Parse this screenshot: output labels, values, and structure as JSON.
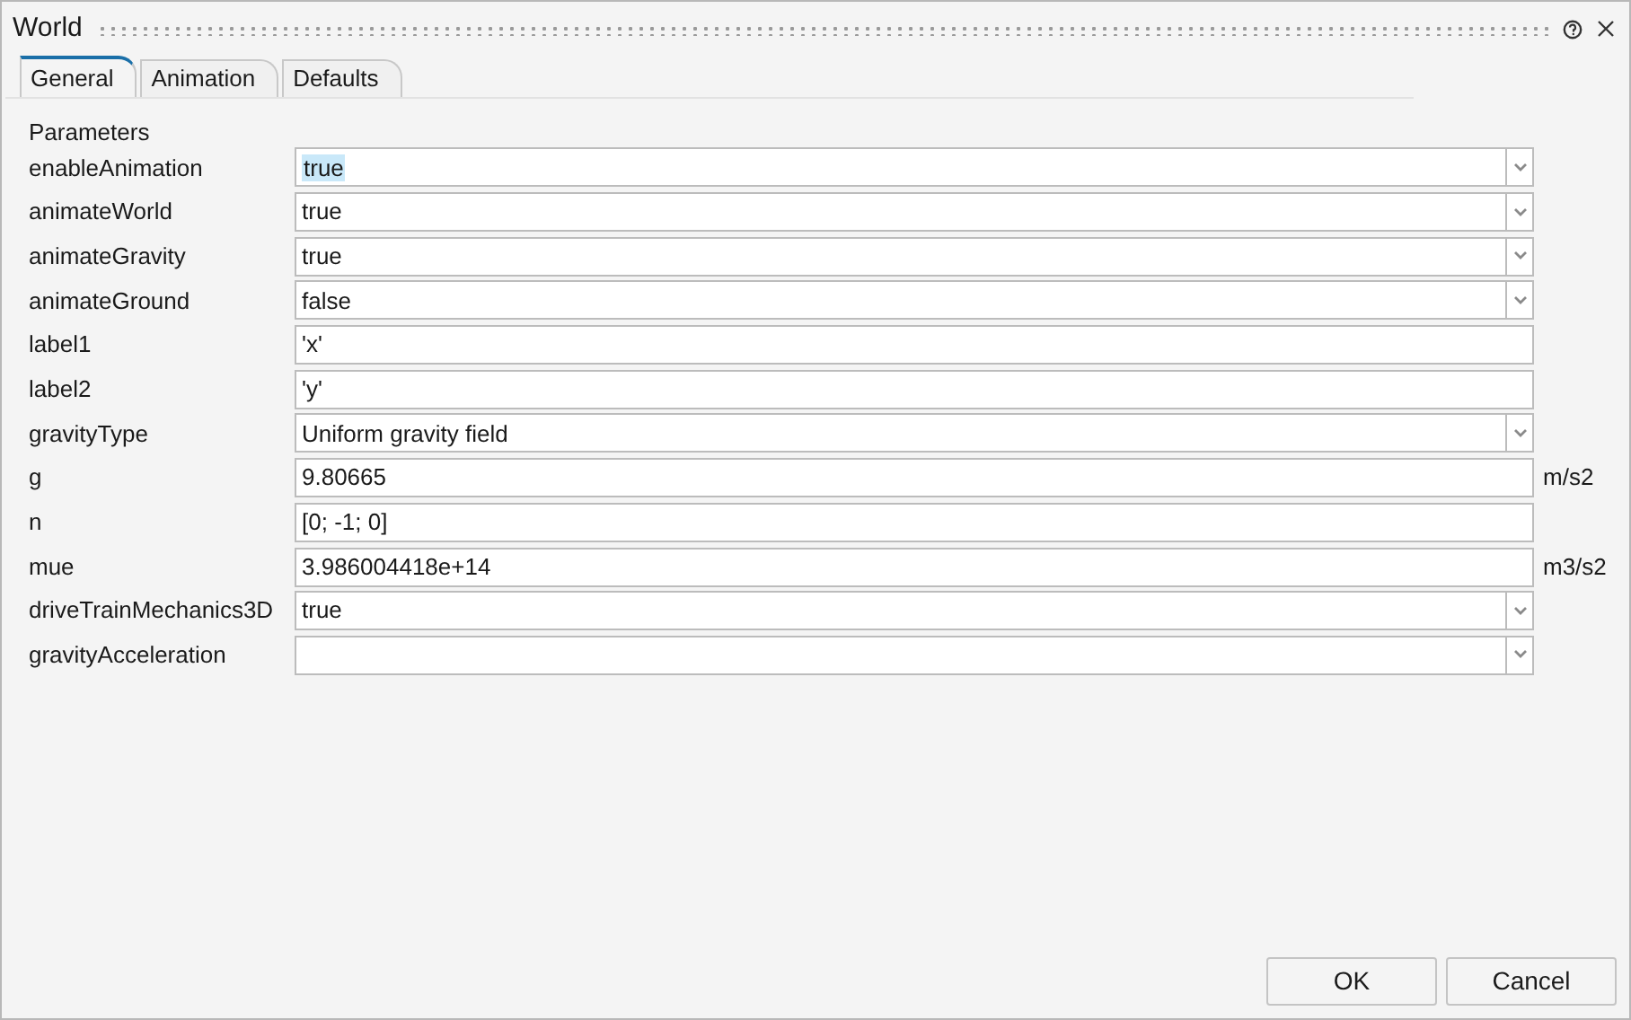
{
  "window": {
    "title": "World"
  },
  "tabs": [
    {
      "label": "General",
      "selected": true
    },
    {
      "label": "Animation",
      "selected": false
    },
    {
      "label": "Defaults",
      "selected": false
    }
  ],
  "section_label": "Parameters",
  "parameters": [
    {
      "name": "enableAnimation",
      "kind": "dropdown",
      "value": "true",
      "highlighted": true
    },
    {
      "name": "animateWorld",
      "kind": "dropdown",
      "value": "true"
    },
    {
      "name": "animateGravity",
      "kind": "dropdown",
      "value": "true"
    },
    {
      "name": "animateGround",
      "kind": "dropdown",
      "value": "false"
    },
    {
      "name": "label1",
      "kind": "text",
      "value": "'x'"
    },
    {
      "name": "label2",
      "kind": "text",
      "value": "'y'"
    },
    {
      "name": "gravityType",
      "kind": "dropdown",
      "value": "Uniform gravity field"
    },
    {
      "name": "g",
      "kind": "text",
      "value": "9.80665",
      "unit": "m/s2"
    },
    {
      "name": "n",
      "kind": "text",
      "value": "[0; -1; 0]"
    },
    {
      "name": "mue",
      "kind": "text",
      "value": "3.986004418e+14",
      "unit": "m3/s2"
    },
    {
      "name": "driveTrainMechanics3D",
      "kind": "dropdown",
      "value": "true"
    },
    {
      "name": "gravityAcceleration",
      "kind": "dropdown"
    }
  ],
  "buttons": [
    "OK",
    "Cancel"
  ]
}
